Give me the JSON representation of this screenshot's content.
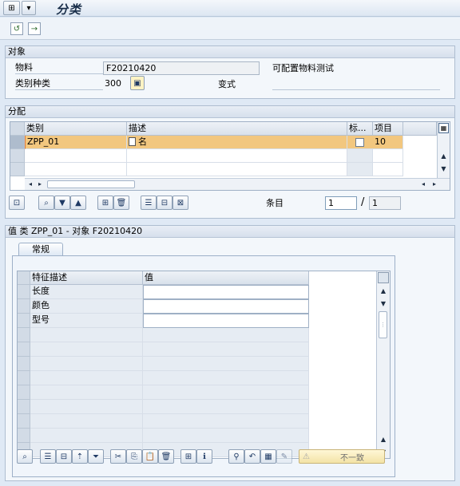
{
  "window": {
    "title": "分类"
  },
  "object_group": {
    "header": "对象",
    "material_label": "物料",
    "material_value": "F20210420",
    "material_desc": "可配置物料测试",
    "class_type_label": "类别种类",
    "class_type_value": "300",
    "class_type_desc": "变式"
  },
  "assignment_group": {
    "header": "分配",
    "columns": [
      "类别",
      "描述",
      "标...",
      "项目"
    ],
    "rows": [
      {
        "class": "ZPP_01",
        "desc": "名",
        "item": "10"
      }
    ],
    "entries_label": "条目",
    "entries_current": "1",
    "entries_sep": "/",
    "entries_total": "1"
  },
  "values_group": {
    "header": "值 类 ZPP_01 - 对象 F20210420",
    "tab_label": "常规",
    "columns": [
      "特征描述",
      "值"
    ],
    "rows": [
      "长度",
      "颜色",
      "型号"
    ],
    "inconsistent_label": "不一致"
  }
}
